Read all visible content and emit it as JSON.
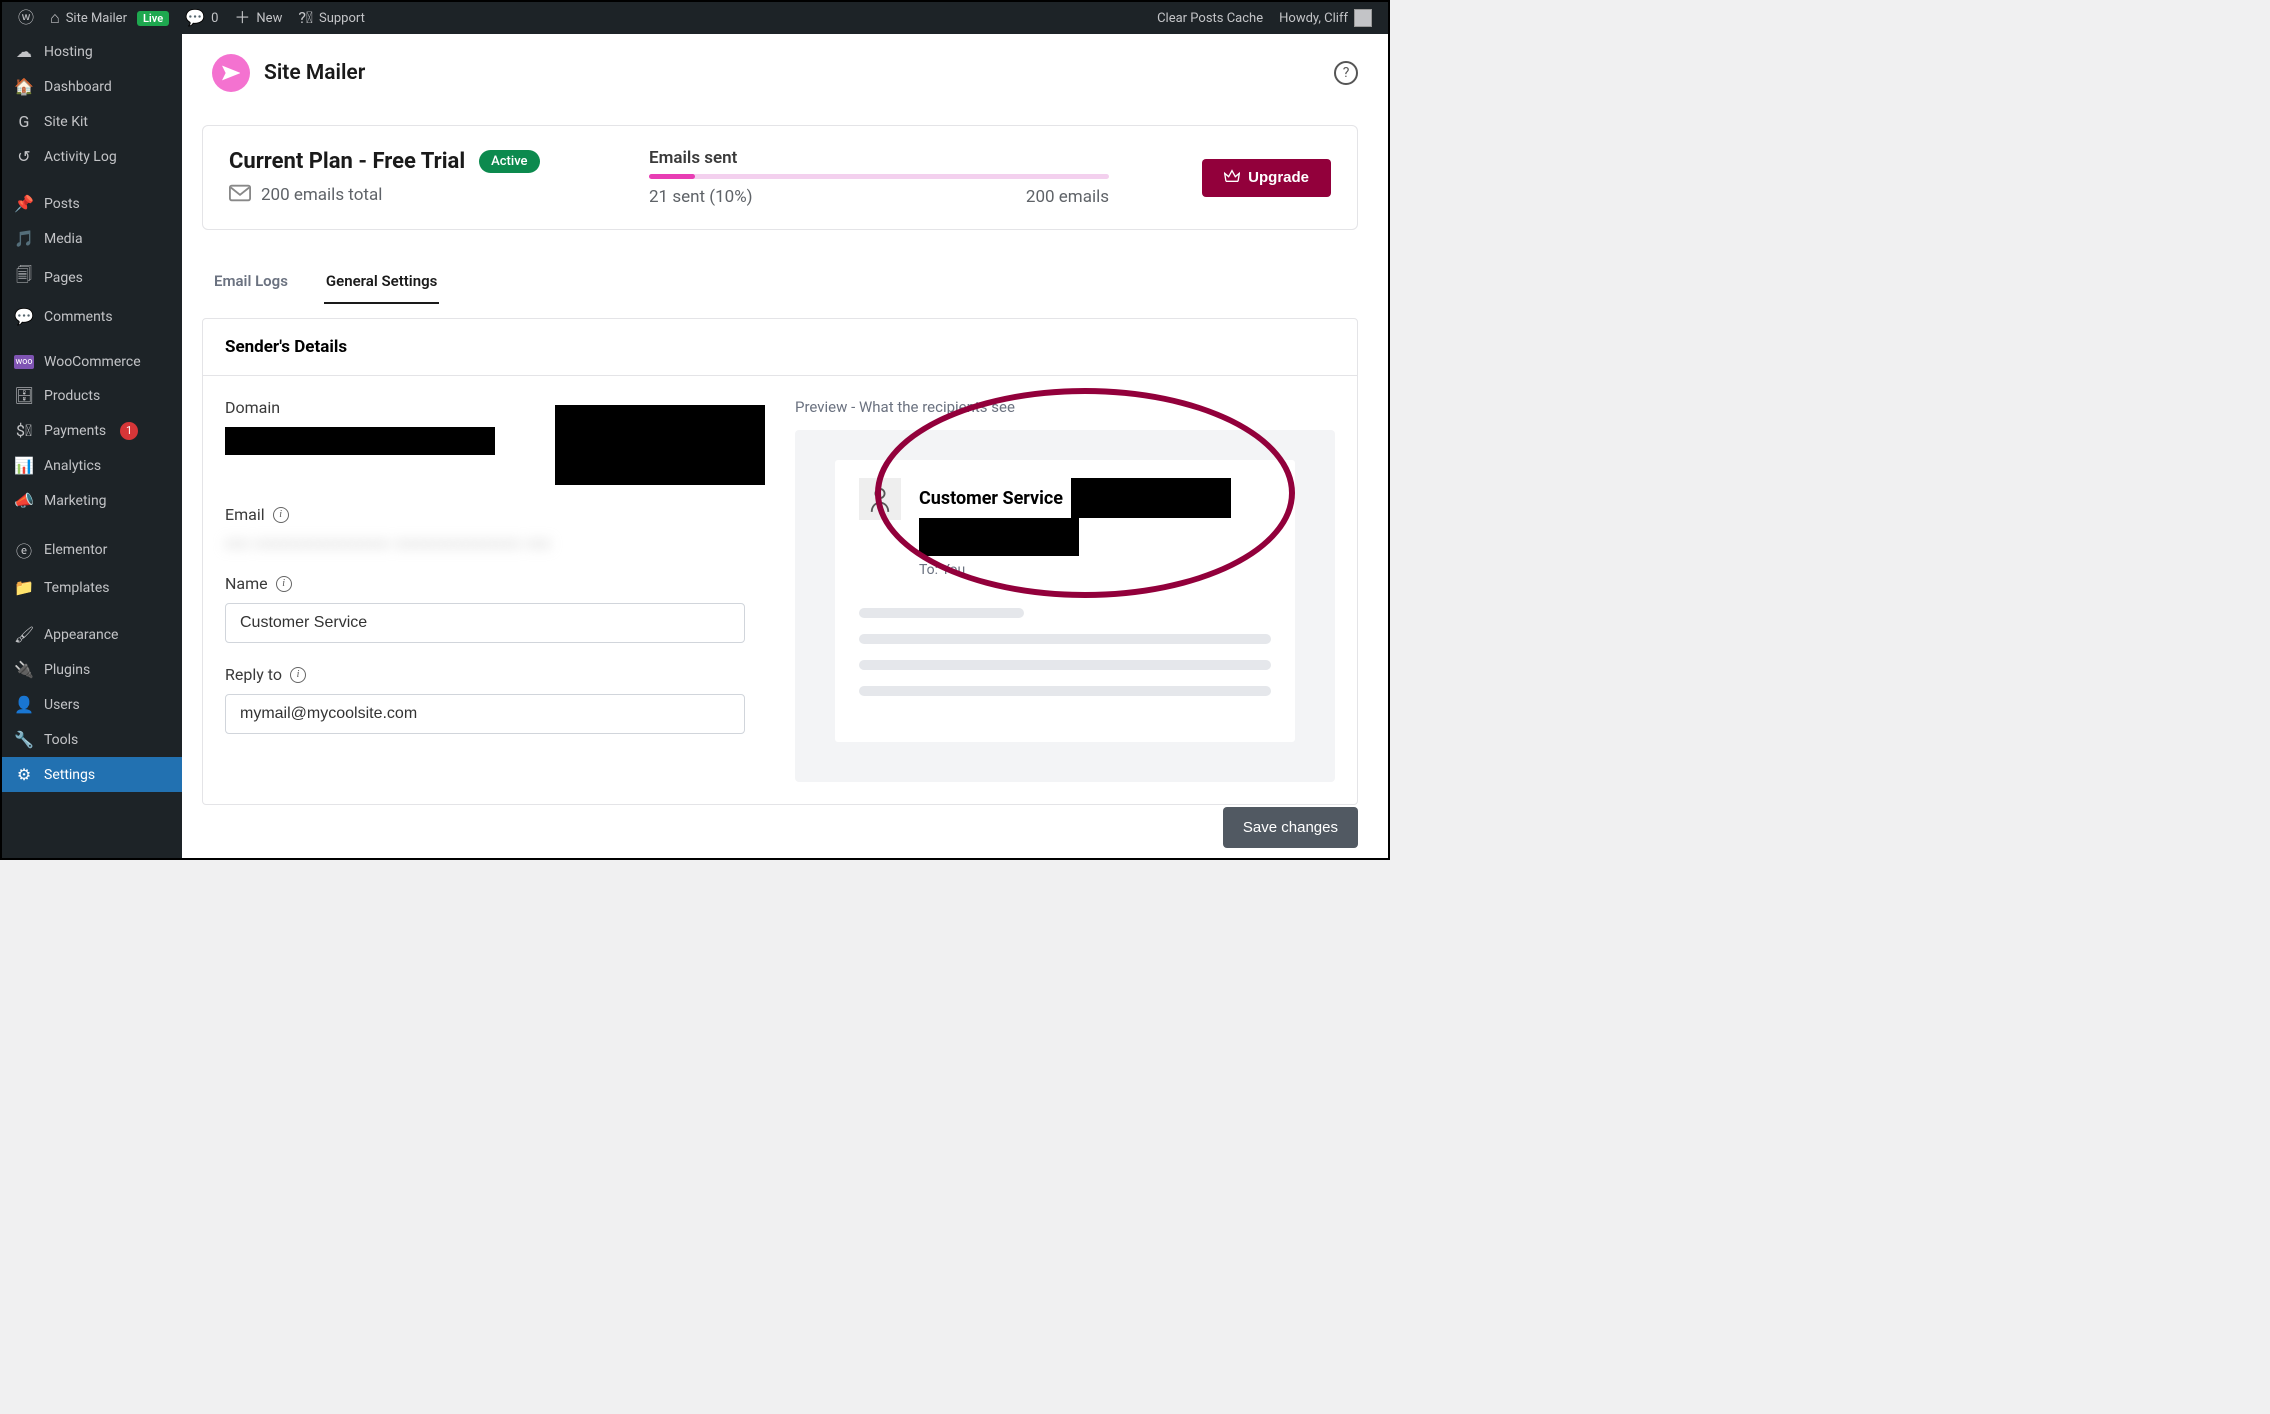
{
  "adminbar": {
    "site_name": "Site Mailer",
    "live_badge": "Live",
    "comments": "0",
    "new_label": "New",
    "support": "Support",
    "clear_cache": "Clear Posts Cache",
    "howdy": "Howdy, Cliff"
  },
  "sidebar": {
    "items": [
      {
        "icon": "cloud",
        "label": "Hosting"
      },
      {
        "icon": "dash",
        "label": "Dashboard"
      },
      {
        "icon": "g",
        "label": "Site Kit"
      },
      {
        "icon": "clock",
        "label": "Activity Log"
      },
      {
        "icon": "pin",
        "label": "Posts"
      },
      {
        "icon": "media",
        "label": "Media"
      },
      {
        "icon": "page",
        "label": "Pages"
      },
      {
        "icon": "comment",
        "label": "Comments"
      },
      {
        "icon": "woo",
        "label": "WooCommerce"
      },
      {
        "icon": "archive",
        "label": "Products"
      },
      {
        "icon": "pay",
        "label": "Payments",
        "badge": "1"
      },
      {
        "icon": "chart",
        "label": "Analytics"
      },
      {
        "icon": "horn",
        "label": "Marketing"
      },
      {
        "icon": "ele",
        "label": "Elementor"
      },
      {
        "icon": "folder",
        "label": "Templates"
      },
      {
        "icon": "brush",
        "label": "Appearance"
      },
      {
        "icon": "plug",
        "label": "Plugins"
      },
      {
        "icon": "user",
        "label": "Users"
      },
      {
        "icon": "wrench",
        "label": "Tools"
      },
      {
        "icon": "gear",
        "label": "Settings",
        "current": true
      }
    ]
  },
  "page": {
    "title": "Site Mailer"
  },
  "plan": {
    "title": "Current Plan - Free Trial",
    "status": "Active",
    "total": "200 emails total",
    "emails_sent_label": "Emails sent",
    "sent_summary": "21 sent (10%)",
    "cap": "200 emails",
    "upgrade": "Upgrade"
  },
  "tabs": {
    "logs": "Email Logs",
    "general": "General Settings"
  },
  "settings": {
    "panel_title": "Sender's Details",
    "domain_label": "Domain",
    "email_label": "Email",
    "name_label": "Name",
    "name_value": "Customer Service",
    "reply_label": "Reply to",
    "reply_value": "mymail@mycoolsite.com",
    "preview_label": "Preview - What the recipients see",
    "preview_name": "Customer Service",
    "preview_to": "To: You",
    "save": "Save changes"
  }
}
